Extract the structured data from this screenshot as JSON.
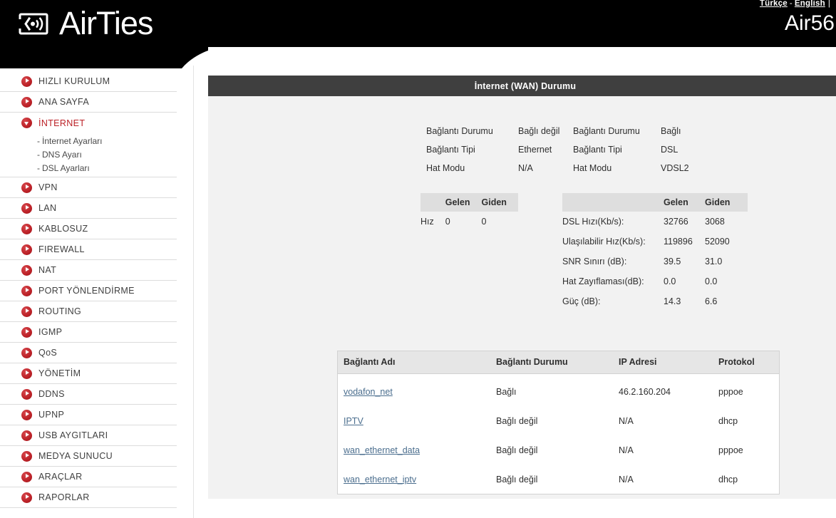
{
  "header": {
    "brand_name": "AirTies",
    "logo_icon": "airties-wifi-logo-icon",
    "model": "Air56",
    "lang_turkish": "Türkçe",
    "lang_separator": "-",
    "lang_english": "English",
    "lang_trailing_pipe": "|",
    "brand_color": "#000000"
  },
  "sidebar": {
    "accent_color": "#bb2026",
    "items": [
      {
        "label": "HIZLI KURULUM",
        "icon": "chevron-right-circle-icon",
        "active": false
      },
      {
        "label": "ANA SAYFA",
        "icon": "chevron-right-circle-icon",
        "active": false
      },
      {
        "label": "İNTERNET",
        "icon": "chevron-down-circle-icon",
        "active": true,
        "children": [
          "İnternet Ayarları",
          "DNS Ayarı",
          "DSL Ayarları"
        ]
      },
      {
        "label": "VPN",
        "icon": "chevron-right-circle-icon",
        "active": false
      },
      {
        "label": "LAN",
        "icon": "chevron-right-circle-icon",
        "active": false
      },
      {
        "label": "KABLOSUZ",
        "icon": "chevron-right-circle-icon",
        "active": false
      },
      {
        "label": "FIREWALL",
        "icon": "chevron-right-circle-icon",
        "active": false
      },
      {
        "label": "NAT",
        "icon": "chevron-right-circle-icon",
        "active": false
      },
      {
        "label": "PORT YÖNLENDİRME",
        "icon": "chevron-right-circle-icon",
        "active": false
      },
      {
        "label": "ROUTING",
        "icon": "chevron-right-circle-icon",
        "active": false
      },
      {
        "label": "IGMP",
        "icon": "chevron-right-circle-icon",
        "active": false
      },
      {
        "label": "QoS",
        "icon": "chevron-right-circle-icon",
        "active": false
      },
      {
        "label": "YÖNETİM",
        "icon": "chevron-right-circle-icon",
        "active": false
      },
      {
        "label": "DDNS",
        "icon": "chevron-right-circle-icon",
        "active": false
      },
      {
        "label": "UPNP",
        "icon": "chevron-right-circle-icon",
        "active": false
      },
      {
        "label": "USB AYGITLARI",
        "icon": "chevron-right-circle-icon",
        "active": false
      },
      {
        "label": "MEDYA SUNUCU",
        "icon": "chevron-right-circle-icon",
        "active": false
      },
      {
        "label": "ARAÇLAR",
        "icon": "chevron-right-circle-icon",
        "active": false
      },
      {
        "label": "RAPORLAR",
        "icon": "chevron-right-circle-icon",
        "active": false
      }
    ]
  },
  "panel": {
    "title": "İnternet (WAN) Durumu",
    "title_bg": "#3f3f3f",
    "body_bg": "#f2f2f2",
    "ethernet_status": {
      "k1": "Bağlantı Durumu",
      "v1": "Bağlı değil",
      "k2": "Bağlantı Tipi",
      "v2": "Ethernet",
      "k3": "Hat Modu",
      "v3": "N/A"
    },
    "dsl_status": {
      "k1": "Bağlantı Durumu",
      "v1": "Bağlı",
      "k2": "Bağlantı Tipi",
      "v2": "DSL",
      "k3": "Hat Modu",
      "v3": "VDSL2"
    },
    "ethernet_speed_table": {
      "col_blank": "",
      "col_in": "Gelen",
      "col_out": "Giden",
      "rows": [
        {
          "label": "Hız",
          "in": "0",
          "out": "0"
        }
      ]
    },
    "dsl_speed_table": {
      "col_blank": "",
      "col_in": "Gelen",
      "col_out": "Giden",
      "rows": [
        {
          "label": "DSL Hızı(Kb/s):",
          "in": "32766",
          "out": "3068"
        },
        {
          "label": "Ulaşılabilir Hız(Kb/s):",
          "in": "119896",
          "out": "52090"
        },
        {
          "label": "SNR Sınırı (dB):",
          "in": "39.5",
          "out": "31.0"
        },
        {
          "label": "Hat Zayıflaması(dB):",
          "in": "0.0",
          "out": "0.0"
        },
        {
          "label": "Güç (dB):",
          "in": "14.3",
          "out": "6.6"
        }
      ]
    },
    "connections_table": {
      "headers": [
        "Bağlantı Adı",
        "Bağlantı Durumu",
        "IP Adresi",
        "Protokol"
      ],
      "link_color": "#4b6e8e",
      "rows": [
        {
          "name": "vodafon_net",
          "status": "Bağlı",
          "ip": "46.2.160.204",
          "protocol": "pppoe"
        },
        {
          "name": "IPTV",
          "status": "Bağlı değil",
          "ip": "N/A",
          "protocol": "dhcp"
        },
        {
          "name": "wan_ethernet_data",
          "status": "Bağlı değil",
          "ip": "N/A",
          "protocol": "pppoe"
        },
        {
          "name": "wan_ethernet_iptv",
          "status": "Bağlı değil",
          "ip": "N/A",
          "protocol": "dhcp"
        }
      ]
    }
  }
}
